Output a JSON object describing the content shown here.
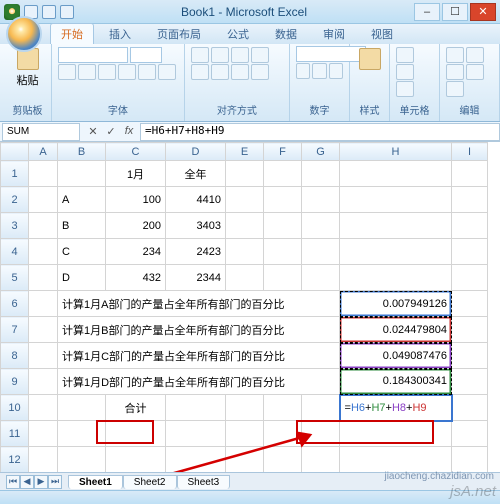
{
  "title": "Book1 - Microsoft Excel",
  "ribbon_tabs": [
    "开始",
    "插入",
    "页面布局",
    "公式",
    "数据",
    "审阅",
    "视图"
  ],
  "groups": {
    "clipboard": "剪贴板",
    "font": "字体",
    "alignment": "对齐方式",
    "number": "数字",
    "style": "样式",
    "cells": "单元格",
    "editing": "编辑"
  },
  "clipboard": {
    "paste": "粘贴"
  },
  "namebox": "SUM",
  "formula": "=H6+H7+H8+H9",
  "cols": [
    "A",
    "B",
    "C",
    "D",
    "E",
    "F",
    "G",
    "H",
    "I"
  ],
  "rows": {
    "1": {
      "C": "1月",
      "D": "全年"
    },
    "2": {
      "B": "A",
      "C": "100",
      "D": "4410"
    },
    "3": {
      "B": "B",
      "C": "200",
      "D": "3403"
    },
    "4": {
      "B": "C",
      "C": "234",
      "D": "2423"
    },
    "5": {
      "B": "D",
      "C": "432",
      "D": "2344"
    },
    "6": {
      "B": "计算1月A部门的产量占全年所有部门的百分比",
      "H": "0.007949126"
    },
    "7": {
      "B": "计算1月B部门的产量占全年所有部门的百分比",
      "H": "0.024479804"
    },
    "8": {
      "B": "计算1月C部门的产量占全年所有部门的百分比",
      "H": "0.049087476"
    },
    "9": {
      "B": "计算1月D部门的产量占全年所有部门的百分比",
      "H": "0.184300341"
    },
    "10": {
      "C": "合计",
      "Hf": [
        "=",
        "H6",
        "+",
        "H7",
        "+",
        "H8",
        "+",
        "H9"
      ]
    }
  },
  "sheets": [
    "Sheet1",
    "Sheet2",
    "Sheet3"
  ],
  "watermark1": "jsA.net",
  "watermark2": "jiaocheng.chazidian.com"
}
